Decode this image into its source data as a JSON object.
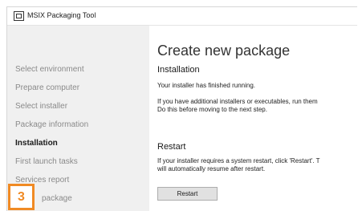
{
  "window": {
    "title": "MSIX Packaging Tool",
    "app_icon": "msix-app-icon"
  },
  "sidebar": {
    "items": [
      {
        "label": "Select environment",
        "active": false
      },
      {
        "label": "Prepare computer",
        "active": false
      },
      {
        "label": "Select installer",
        "active": false
      },
      {
        "label": "Package information",
        "active": false
      },
      {
        "label": "Installation",
        "active": true
      },
      {
        "label": "First launch tasks",
        "active": false
      },
      {
        "label": "Services report",
        "active": false
      },
      {
        "label": "package",
        "active": false
      }
    ]
  },
  "main": {
    "title": "Create new package",
    "installation": {
      "heading": "Installation",
      "status": "Your installer has finished running.",
      "info_line1": "If you have additional installers or executables, run them",
      "info_line2": "Do this before moving to the next step."
    },
    "restart": {
      "heading": "Restart",
      "info_line1": "If your installer requires a system restart, click 'Restart'. T",
      "info_line2": "will automatically resume after restart.",
      "button_label": "Restart"
    }
  },
  "step_badge": {
    "number": "3",
    "color": "#f08a24"
  },
  "colors": {
    "sidebar_bg": "#f0f0f0",
    "nav_inactive": "#8a8a8a",
    "nav_active": "#1a1a1a",
    "button_bg": "#e1e1e1"
  }
}
